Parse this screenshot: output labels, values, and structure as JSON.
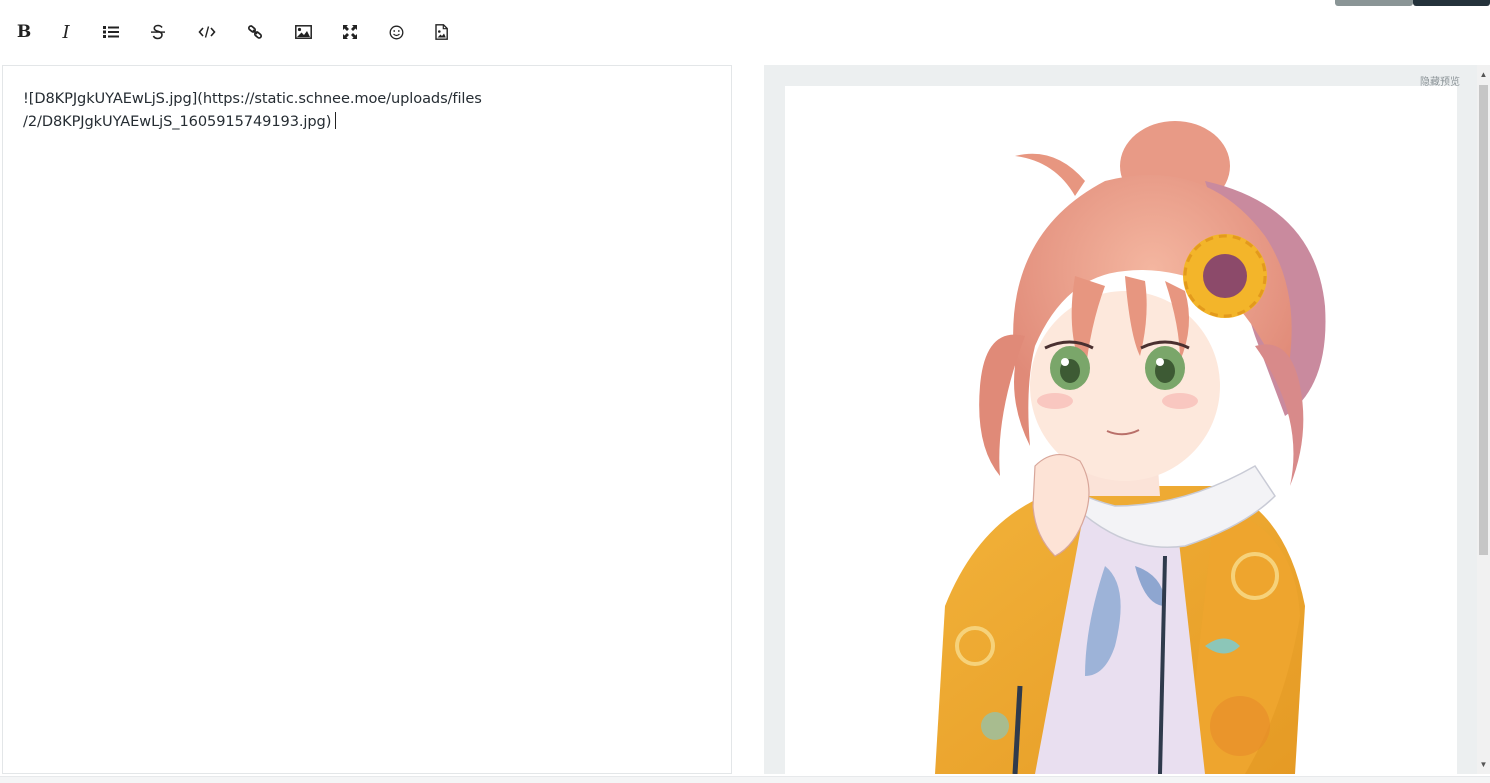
{
  "toolbar": {
    "bold_label": "B",
    "italic_label": "I",
    "tools": [
      "bold-icon",
      "italic-icon",
      "list-icon",
      "strikethrough-icon",
      "code-icon",
      "link-icon",
      "image-icon",
      "fullscreen-icon",
      "emoji-icon",
      "file-image-icon"
    ]
  },
  "editor": {
    "line1": "![D8KPJgkUYAEwLjS.jpg](https://static.schnee.moe/uploads/files",
    "line2": "/2/D8KPJgkUYAEwLjS_1605915749193.jpg)"
  },
  "preview": {
    "hide_label": "隐藏预览"
  },
  "colors": {
    "accent_dark": "#24323b",
    "accent_gray": "#8a9596",
    "preview_bg": "#eceff0"
  }
}
